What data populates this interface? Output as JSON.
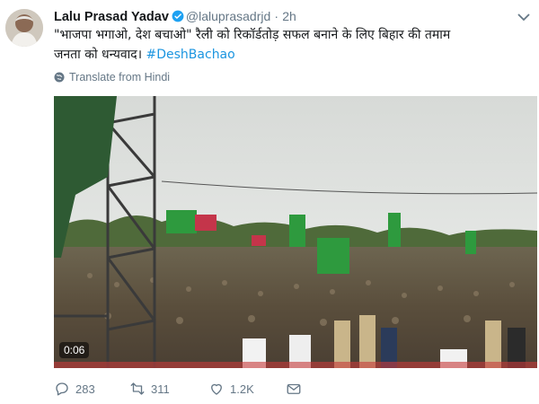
{
  "tweet": {
    "author_name": "Lalu Prasad Yadav",
    "handle": "@laluprasadrjd",
    "separator": "·",
    "time": "2h",
    "text_line1": "\"भाजपा भगाओ, देश बचाओ\" रैली को रिकॉर्डतोड़ सफल बनाने के लिए बिहार की तमाम",
    "text_line2": "जनता को धन्यवाद।",
    "hashtag": "#DeshBachao",
    "translate_label": "Translate from Hindi"
  },
  "video": {
    "timecode": "0:06"
  },
  "actions": {
    "replies": "283",
    "retweets": "311",
    "likes": "1.2K"
  },
  "colors": {
    "link": "#1b95e0",
    "secondary_text": "#657786",
    "verified": "#1da1f2"
  },
  "icons": [
    "verified-icon",
    "chevron-down-icon",
    "globe-icon",
    "reply-icon",
    "retweet-icon",
    "like-icon",
    "dm-icon"
  ]
}
